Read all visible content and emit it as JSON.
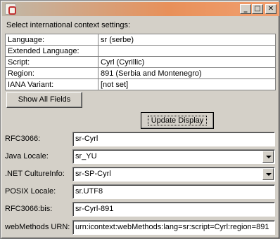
{
  "window": {
    "icon": "app-icon",
    "controls": {
      "minimize": "_",
      "maximize": "□",
      "close": "✕"
    }
  },
  "intro": "Select international context settings:",
  "table": {
    "rows": [
      {
        "key": "Language:",
        "value": "sr (serbe)"
      },
      {
        "key": "Extended Language:",
        "value": ""
      },
      {
        "key": "Script:",
        "value": "Cyrl (Cyrillic)"
      },
      {
        "key": "Region:",
        "value": "891 (Serbia and Montenegro)"
      },
      {
        "key": "IANA Variant:",
        "value": "[not set]"
      }
    ]
  },
  "buttons": {
    "show_all": "Show All Fields",
    "update": "Update Display"
  },
  "fields": {
    "rfc3066": {
      "label": "RFC3066:",
      "value": "sr-Cyrl"
    },
    "java_locale": {
      "label": "Java Locale:",
      "value": "sr_YU"
    },
    "net_culture": {
      "label": ".NET CultureInfo:",
      "value": "sr-SP-Cyrl"
    },
    "posix_locale": {
      "label": "POSIX Locale:",
      "value": "sr.UTF8"
    },
    "rfc3066bis": {
      "label": "RFC3066:bis:",
      "value": "sr-Cyrl-891"
    },
    "webmethods_urn": {
      "label": "webMethods URN:",
      "value": "urn:icontext:webMethods:lang=sr:script=Cyrl:region=891"
    }
  }
}
